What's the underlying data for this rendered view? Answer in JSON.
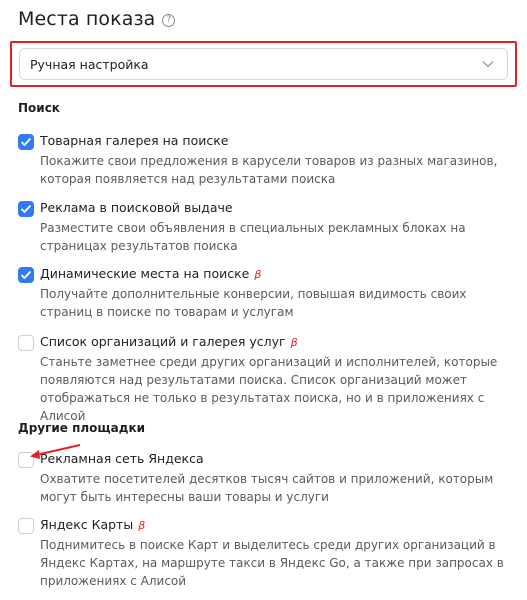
{
  "header": {
    "title": "Места показа",
    "help_icon": "help-circle-icon"
  },
  "placement_select": {
    "value": "Ручная настройка",
    "icon": "chevron-down-icon"
  },
  "sections": {
    "search_title": "Поиск",
    "other_title": "Другие площадки"
  },
  "options": [
    {
      "label": "Товарная галерея на поиске",
      "checked": true,
      "beta": "",
      "description": "Покажите свои предложения в карусели товаров из разных магазинов, которая появляется над результатами поиска"
    },
    {
      "label": "Реклама в поисковой выдаче",
      "checked": true,
      "beta": "",
      "description": "Разместите свои объявления в специальных рекламных блоках на страницах результатов поиска"
    },
    {
      "label": "Динамические места на поиске",
      "checked": true,
      "beta": "β",
      "description": "Получайте дополнительные конверсии, повышая видимость своих страниц в поиске по товарам и услугам"
    },
    {
      "label": "Список организаций и галерея услуг",
      "checked": false,
      "beta": "β",
      "description": "Станьте заметнее среди других организаций и исполнителей, которые появляются над результатами поиска. Список организаций может отображаться не только в результатах поиска, но и в приложениях с Алисой"
    },
    {
      "label": "Рекламная сеть Яндекса",
      "checked": false,
      "beta": "",
      "description": "Охватите посетителей десятков тысяч сайтов и приложений, которым могут быть интересны ваши товары и услуги"
    },
    {
      "label": "Яндекс Карты",
      "checked": false,
      "beta": "β",
      "description": "Поднимитесь в поиске Карт и выделитесь среди других организаций в Яндекс Картах, на маршруте такси в Яндекс Go, а также при запросах в приложениях с Алисой"
    }
  ],
  "colors": {
    "accent_blue": "#2f7bf5",
    "highlight_red": "#e3202a"
  }
}
